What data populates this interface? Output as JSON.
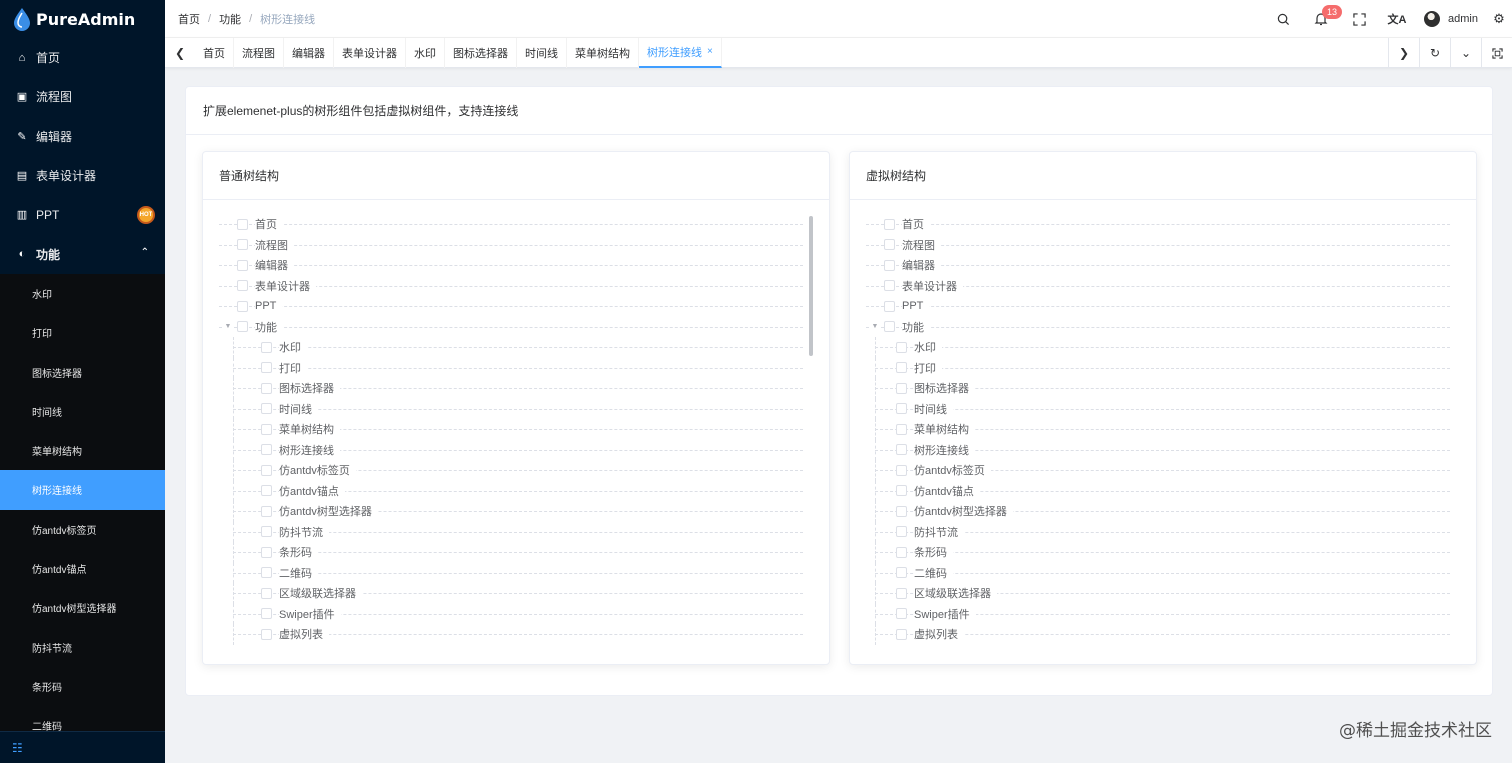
{
  "app": {
    "name": "PureAdmin"
  },
  "sidebar": {
    "items": [
      {
        "label": "首页",
        "icon": "home-icon"
      },
      {
        "label": "流程图",
        "icon": "flowchart-icon"
      },
      {
        "label": "编辑器",
        "icon": "edit-icon"
      },
      {
        "label": "表单设计器",
        "icon": "form-icon"
      },
      {
        "label": "PPT",
        "icon": "ppt-icon",
        "hot": "HOT"
      },
      {
        "label": "功能",
        "icon": "feature-icon",
        "open": true
      }
    ],
    "submenu": [
      {
        "label": "水印"
      },
      {
        "label": "打印"
      },
      {
        "label": "图标选择器"
      },
      {
        "label": "时间线"
      },
      {
        "label": "菜单树结构"
      },
      {
        "label": "树形连接线",
        "active": true
      },
      {
        "label": "仿antdv标签页"
      },
      {
        "label": "仿antdv锚点"
      },
      {
        "label": "仿antdv树型选择器"
      },
      {
        "label": "防抖节流"
      },
      {
        "label": "条形码"
      },
      {
        "label": "二维码"
      }
    ],
    "collapse_icon": "☷"
  },
  "breadcrumb": [
    "首页",
    "功能",
    "树形连接线"
  ],
  "header": {
    "notifications": "13",
    "username": "admin"
  },
  "tabs": [
    {
      "label": "首页"
    },
    {
      "label": "流程图"
    },
    {
      "label": "编辑器"
    },
    {
      "label": "表单设计器"
    },
    {
      "label": "水印"
    },
    {
      "label": "图标选择器"
    },
    {
      "label": "时间线"
    },
    {
      "label": "菜单树结构"
    },
    {
      "label": "树形连接线",
      "active": true,
      "close": "×"
    }
  ],
  "page": {
    "description": "扩展elemenet-plus的树形组件包括虚拟树组件，支持连接线",
    "left_title": "普通树结构",
    "right_title": "虚拟树结构"
  },
  "tree": {
    "top": [
      "首页",
      "流程图",
      "编辑器",
      "表单设计器",
      "PPT"
    ],
    "group": "功能",
    "children": [
      "水印",
      "打印",
      "图标选择器",
      "时间线",
      "菜单树结构",
      "树形连接线",
      "仿antdv标签页",
      "仿antdv锚点",
      "仿antdv树型选择器",
      "防抖节流",
      "条形码",
      "二维码",
      "区域级联选择器",
      "Swiper插件",
      "虚拟列表"
    ]
  },
  "watermark": "@稀土掘金技术社区",
  "colors": {
    "sidebar_bg": "#001529",
    "accent": "#409eff",
    "badge": "#f56c6c"
  }
}
